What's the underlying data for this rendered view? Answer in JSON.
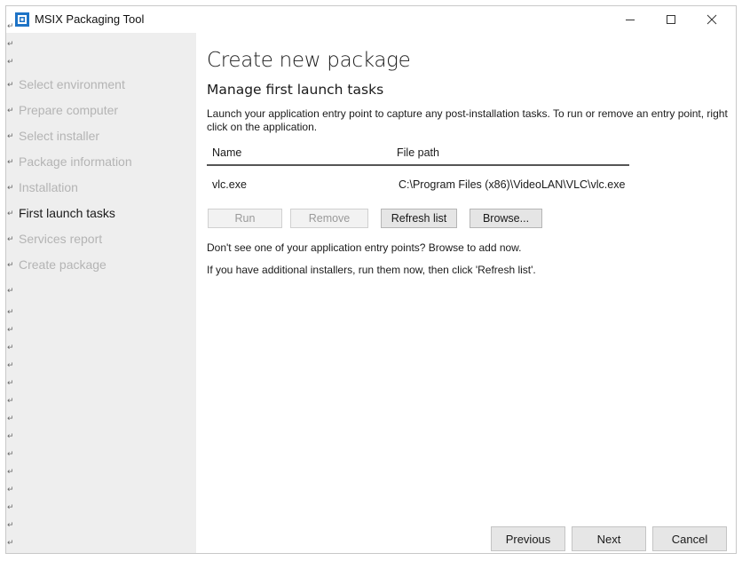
{
  "window": {
    "title": "MSIX Packaging Tool",
    "controls": [
      "minimize",
      "maximize",
      "close"
    ]
  },
  "sidebar": {
    "items": [
      {
        "label": "Select environment",
        "state": "disabled"
      },
      {
        "label": "Prepare computer",
        "state": "disabled"
      },
      {
        "label": "Select installer",
        "state": "disabled"
      },
      {
        "label": "Package information",
        "state": "disabled"
      },
      {
        "label": "Installation",
        "state": "disabled"
      },
      {
        "label": "First launch tasks",
        "state": "active"
      },
      {
        "label": "Services report",
        "state": "disabled"
      },
      {
        "label": "Create package",
        "state": "disabled"
      }
    ]
  },
  "main": {
    "page_title": "Create new package",
    "section_title": "Manage first launch tasks",
    "description": "Launch your application entry point to capture any post-installation tasks. To run or remove an entry point, right click on the application.",
    "table": {
      "columns": [
        "Name",
        "File path"
      ],
      "rows": [
        {
          "name": "vlc.exe",
          "path": "C:\\Program Files (x86)\\VideoLAN\\VLC\\vlc.exe"
        }
      ]
    },
    "buttons": {
      "run": "Run",
      "remove": "Remove",
      "refresh": "Refresh list",
      "browse": "Browse..."
    },
    "info_browse": "Don't see one of your application entry points? Browse to add now.",
    "info_installers": "If you have additional installers, run them now, then click 'Refresh list'."
  },
  "footer": {
    "previous": "Previous",
    "next": "Next",
    "cancel": "Cancel"
  },
  "colors": {
    "sidebar_bg": "#eeeeee",
    "nav_disabled": "#b4b4b4",
    "nav_active": "#1a1a1a",
    "icon_blue": "#1e73c6"
  }
}
